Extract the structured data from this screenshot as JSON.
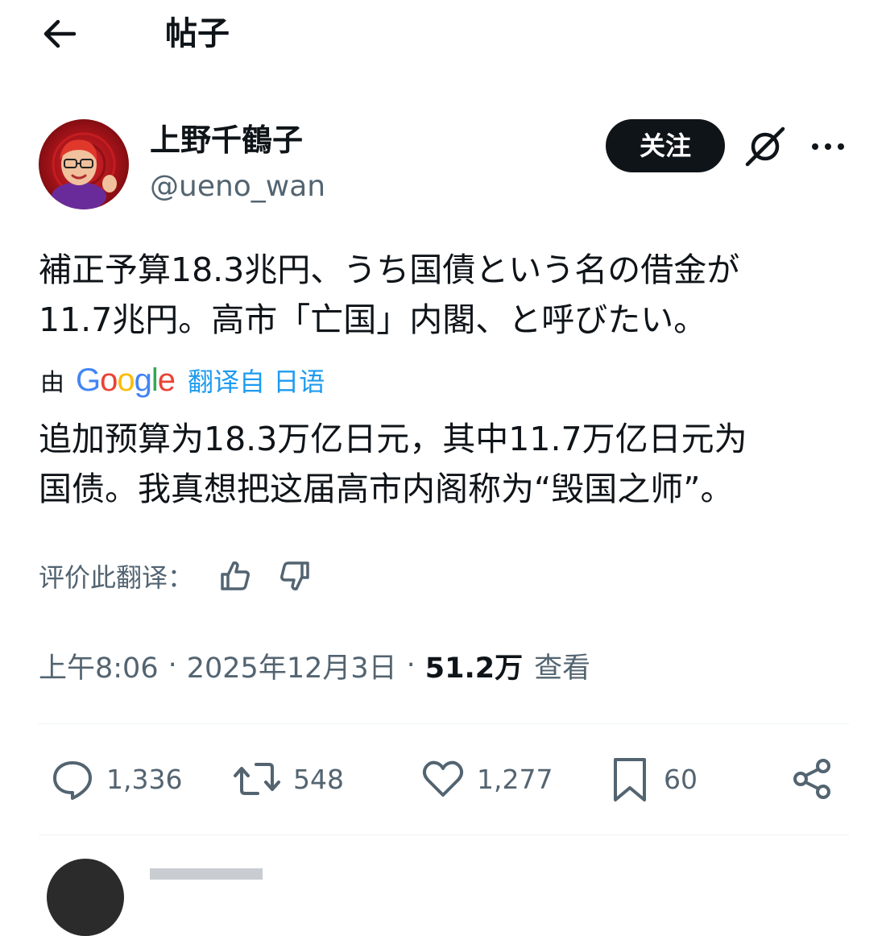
{
  "header": {
    "title": "帖子"
  },
  "author": {
    "display_name": "上野千鶴子",
    "handle": "@ueno_wan"
  },
  "follow_button": {
    "label": "关注"
  },
  "post": {
    "text": "補正予算18.3兆円、うち国債という名の借金が\n11.7兆円。高市「亡国」内閣、と呼びたい。"
  },
  "translation": {
    "by_label": "由",
    "provider": "Google",
    "link_label": "翻译自 日语",
    "text": "追加预算为18.3万亿日元，其中11.7万亿日元为\n国债。我真想把这届高市内阁称为“毁国之师”。",
    "rate_label": "评价此翻译："
  },
  "meta": {
    "time": "上午8:06",
    "separator": "·",
    "date": "2025年12月3日",
    "views_count": "51.2万",
    "views_label": "查看"
  },
  "actions": {
    "replies": "1,336",
    "reposts": "548",
    "likes": "1,277",
    "bookmarks": "60"
  },
  "icons": {
    "back": "arrow-left-icon",
    "grok": "grok-icon",
    "more": "more-horizontal-icon",
    "thumbs_up": "thumbs-up-icon",
    "thumbs_down": "thumbs-down-icon",
    "reply": "reply-icon",
    "repost": "repost-icon",
    "like": "heart-icon",
    "bookmark": "bookmark-icon",
    "share": "share-icon"
  },
  "colors": {
    "text_primary": "#0f1419",
    "text_secondary": "#536471",
    "link": "#1d9bf0",
    "follow_bg": "#0f1419",
    "divider": "#eff3f4"
  }
}
